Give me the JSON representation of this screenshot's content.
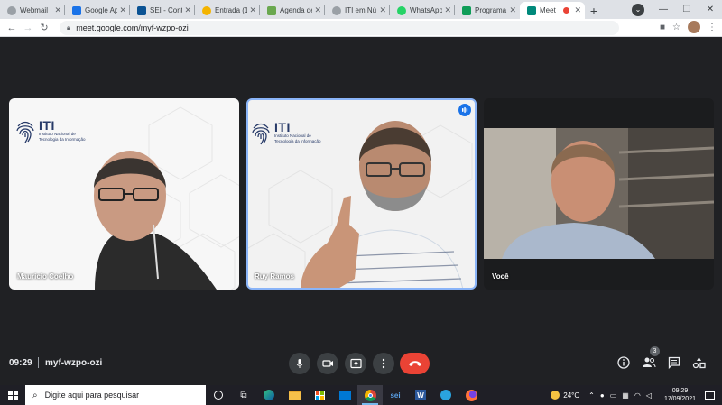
{
  "browser": {
    "tabs": [
      {
        "title": "Webmail",
        "favicon_color": "#9aa0a6"
      },
      {
        "title": "Google Ap",
        "favicon_color": "#1a73e8"
      },
      {
        "title": "SEI - Cont",
        "favicon_color": "#0b5394"
      },
      {
        "title": "Entrada (1",
        "favicon_color": "#f4b400"
      },
      {
        "title": "Agenda de",
        "favicon_color": "#6aa84f"
      },
      {
        "title": "ITI em Nú",
        "favicon_color": "#9aa0a6"
      },
      {
        "title": "WhatsApp",
        "favicon_color": "#25d366"
      },
      {
        "title": "Programa",
        "favicon_color": "#0f9d58"
      },
      {
        "title": "Meet",
        "favicon_color": "#00897b",
        "active": true
      }
    ],
    "new_tab": "+",
    "url": "meet.google.com/myf-wzpo-ozi"
  },
  "meet": {
    "participants": [
      {
        "name": "Mauricio Coelho",
        "brand": "ITI",
        "brand_sub": "Instituto Nacional de Tecnologia da Informação"
      },
      {
        "name": "Ruy Ramos",
        "brand": "ITI",
        "brand_sub": "Instituto Nacional de Tecnologia da Informação",
        "speaking": true
      },
      {
        "name": "Você"
      }
    ],
    "time": "09:29",
    "meeting_code": "myf-wzpo-ozi",
    "participant_count": "3"
  },
  "taskbar": {
    "search_placeholder": "Digite aqui para pesquisar",
    "temperature": "24°C",
    "time": "09:29",
    "date": "17/09/2021"
  },
  "colors": {
    "meet_bg": "#202124",
    "end_call": "#ea4335",
    "speaking_accent": "#8ab4f8"
  }
}
